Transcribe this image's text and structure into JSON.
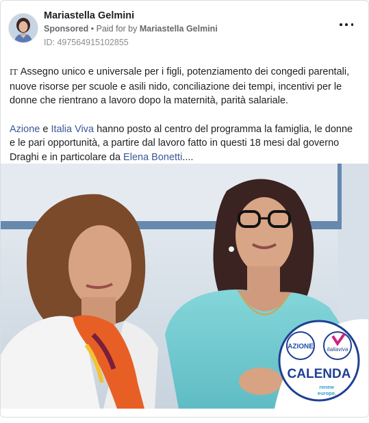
{
  "post": {
    "author": "Mariastella Gelmini",
    "sponsored_label": "Sponsored",
    "paid_for_prefix": " • Paid for by ",
    "paid_for_name": "Mariastella Gelmini",
    "id_label": "ID: 497564915102855",
    "more_icon": "more-horizontal-icon",
    "body": {
      "lang_mark": "IT",
      "paragraph1": "Assegno unico e universale per i figli, potenziamento dei congedi parentali, nuove risorse per scuole e asili nido, conciliazione dei tempi, incentivi per le donne che rientrano a lavoro dopo la maternità, parità salariale.",
      "link_azione": "Azione",
      "conj1": " e ",
      "link_italia_viva": "Italia Viva",
      "paragraph2_mid": " hanno posto al centro del programma la famiglia, le donne e le pari opportunità, a partire dal lavoro fatto in questi 18 mesi dal governo Draghi e in particolare da ",
      "link_bonetti": "Elena Bonetti",
      "ellipsis": "...."
    },
    "image": {
      "logo": {
        "azione": "AZIONE",
        "italiaviva": "italiaviva",
        "calenda": "CALENDA",
        "renew": "renew",
        "europe": "europe."
      }
    },
    "colors": {
      "link": "#385898",
      "secondary_text": "#65676b",
      "calenda_blue": "#1e3f94",
      "italia_viva_pink": "#d4217f",
      "azione_blue": "#1f4fa8"
    }
  }
}
